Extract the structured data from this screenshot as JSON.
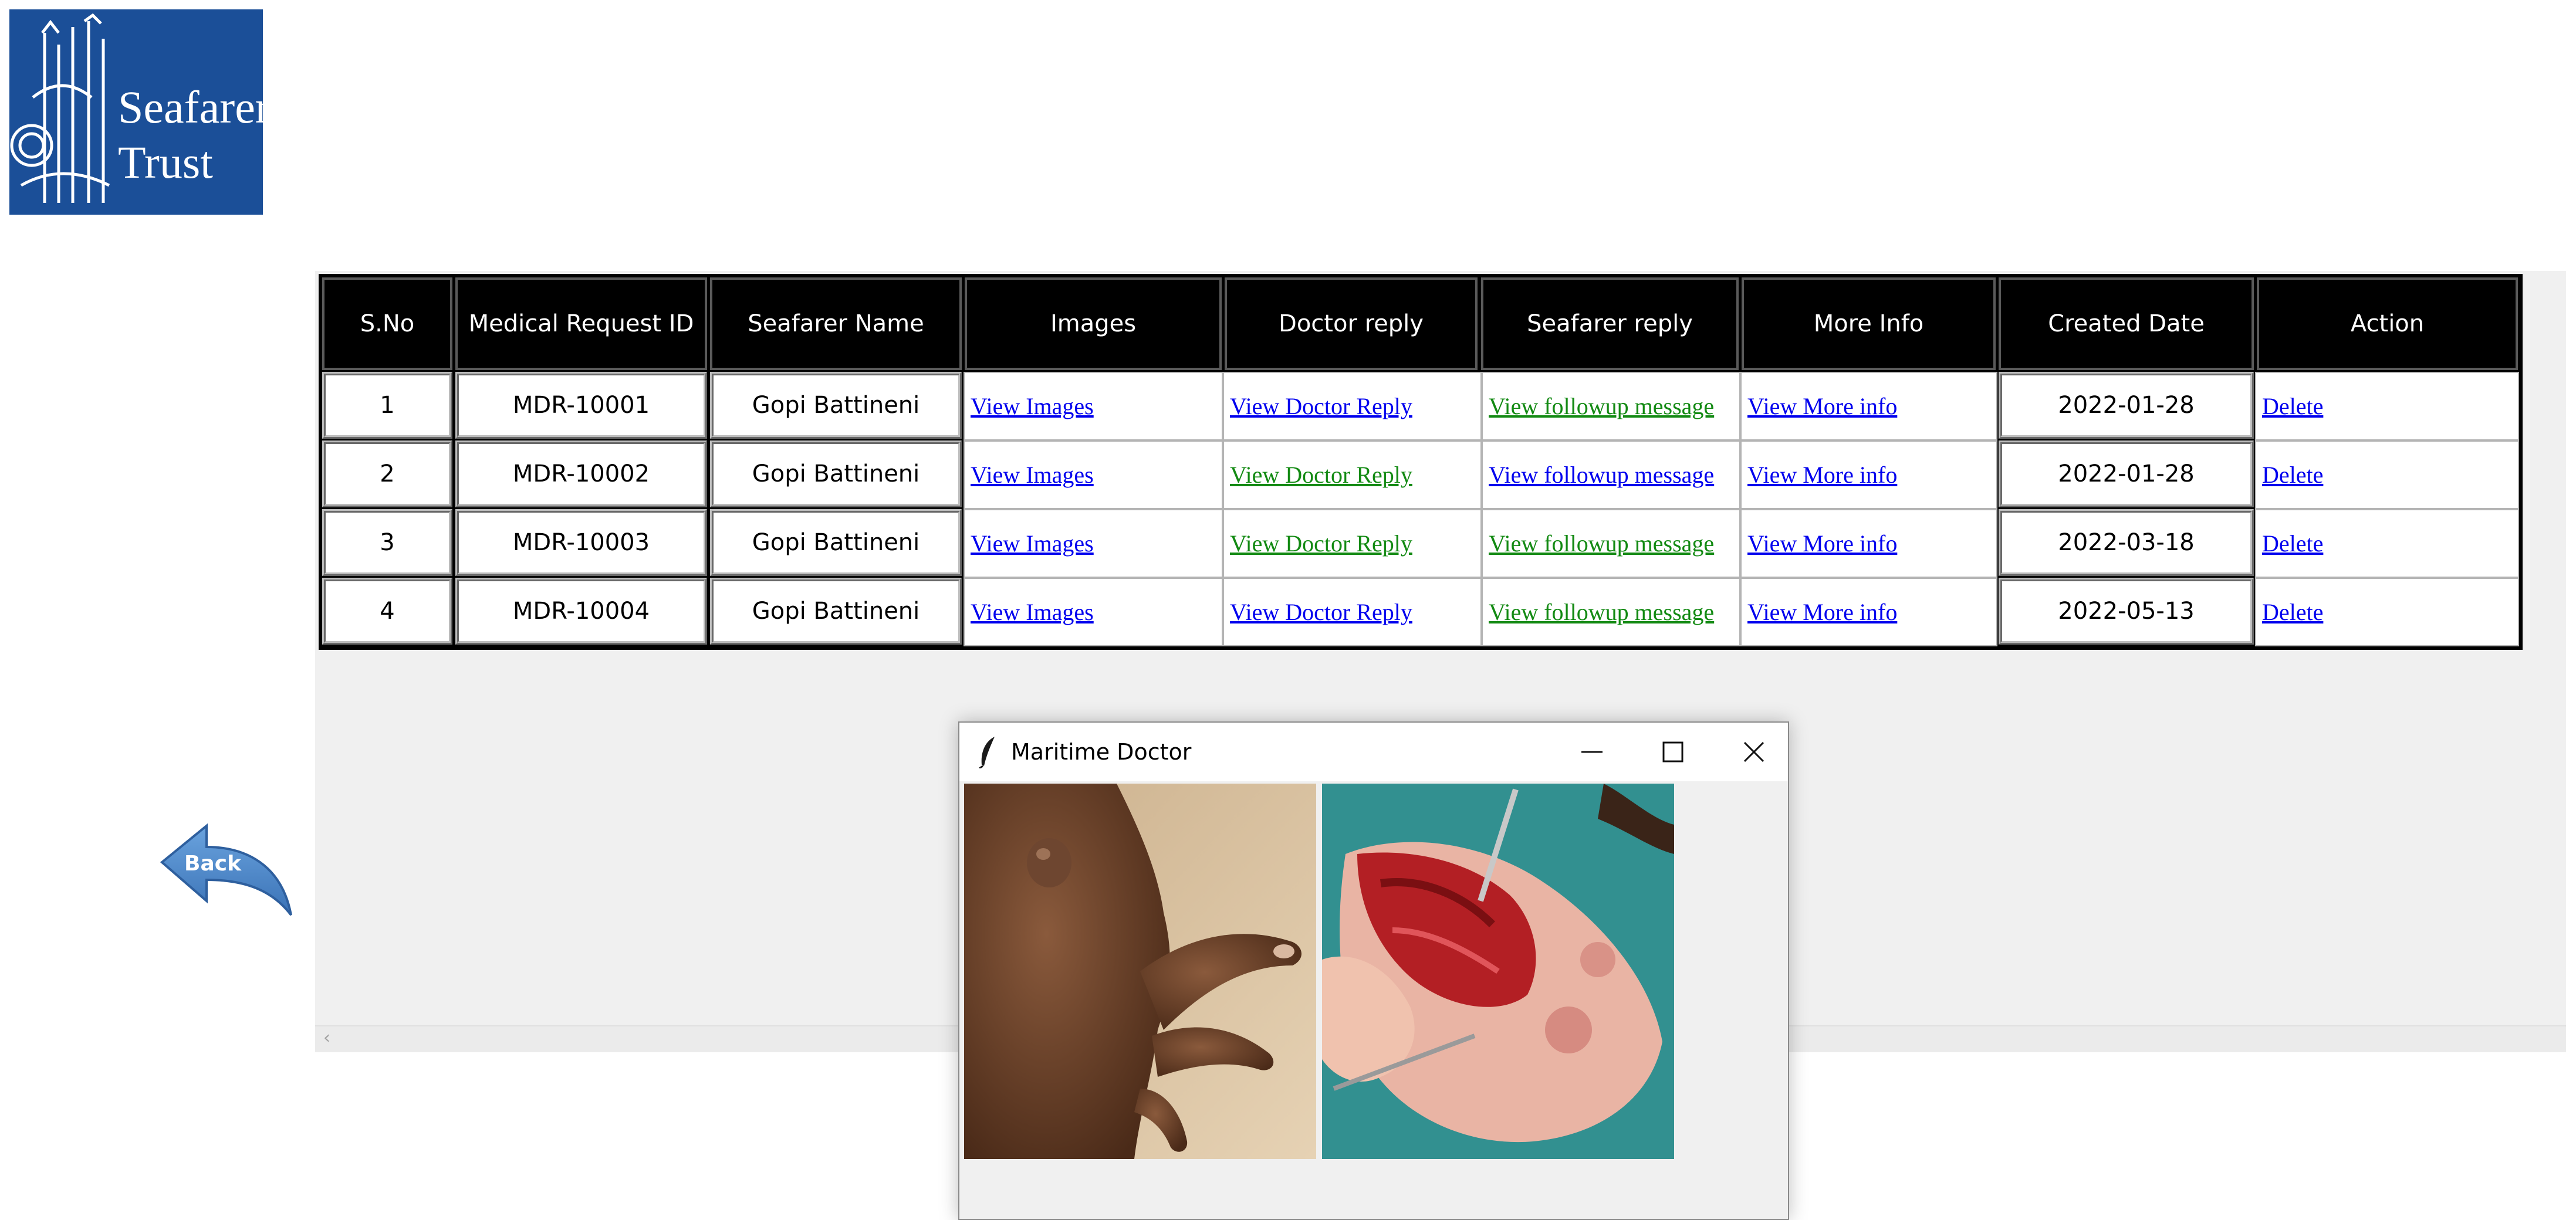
{
  "logo": {
    "line1": "Seafarers'",
    "line2": "Trust"
  },
  "table": {
    "headers": [
      "S.No",
      "Medical Request ID",
      "Seafarer Name",
      "Images",
      "Doctor reply",
      "Seafarer reply",
      "More Info",
      "Created Date",
      "Action"
    ],
    "rows": [
      {
        "sno": "1",
        "id": "MDR-10001",
        "name": "Gopi Battineni",
        "images": "View Images",
        "doctor_reply": "View Doctor Reply",
        "doctor_reply_color": "#0000ee",
        "seafarer_reply": "View followup message",
        "seafarer_reply_color": "#138a13",
        "more_info": "View More info",
        "date": "2022-01-28",
        "action": "Delete"
      },
      {
        "sno": "2",
        "id": "MDR-10002",
        "name": "Gopi Battineni",
        "images": "View Images",
        "doctor_reply": "View Doctor Reply",
        "doctor_reply_color": "#138a13",
        "seafarer_reply": "View followup message",
        "seafarer_reply_color": "#0000ee",
        "more_info": "View More info",
        "date": "2022-01-28",
        "action": "Delete"
      },
      {
        "sno": "3",
        "id": "MDR-10003",
        "name": "Gopi Battineni",
        "images": "View Images",
        "doctor_reply": "View Doctor Reply",
        "doctor_reply_color": "#138a13",
        "seafarer_reply": "View followup message",
        "seafarer_reply_color": "#138a13",
        "more_info": "View More info",
        "date": "2022-03-18",
        "action": "Delete"
      },
      {
        "sno": "4",
        "id": "MDR-10004",
        "name": "Gopi Battineni",
        "images": "View Images",
        "doctor_reply": "View Doctor Reply",
        "doctor_reply_color": "#0000ee",
        "seafarer_reply": "View followup message",
        "seafarer_reply_color": "#138a13",
        "more_info": "View More info",
        "date": "2022-05-13",
        "action": "Delete"
      }
    ]
  },
  "back_button": {
    "label": "Back"
  },
  "dialog": {
    "title": "Maritime Doctor",
    "images": [
      "hand-with-lump-image",
      "hand-surgery-image"
    ]
  },
  "colors": {
    "logo_bg": "#1b4f98",
    "link_blue": "#0000ee",
    "link_green": "#138a13",
    "header_bg": "#000000",
    "panel_bg": "#f0f0f0",
    "back_arrow": "#4a86c8"
  },
  "icons": [
    "feather-icon",
    "minimize-icon",
    "maximize-icon",
    "close-icon",
    "back-arrow-icon",
    "scroll-left-icon"
  ]
}
